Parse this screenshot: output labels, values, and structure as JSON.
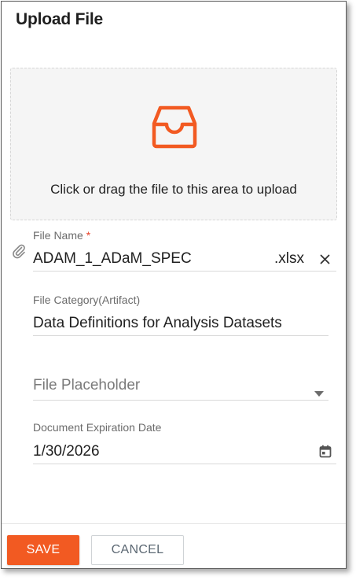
{
  "dialog": {
    "title": "Upload File"
  },
  "dropzone": {
    "icon": "inbox-icon",
    "hint": "Click or drag the file to this area to upload",
    "accent_color": "#f25a22"
  },
  "file_name": {
    "label": "File Name",
    "required_marker": "*",
    "value": "ADAM_1_ADaM_SPEC",
    "extension": ".xlsx",
    "attachment_icon": "paperclip-icon",
    "clear_icon": "close-icon"
  },
  "file_category": {
    "label": "File Category(Artifact)",
    "value": "Data Definitions for Analysis Datasets"
  },
  "file_placeholder": {
    "placeholder": "File Placeholder",
    "icon": "caret-down-icon"
  },
  "expiration": {
    "label": "Document Expiration Date",
    "value": "1/30/2026",
    "icon": "calendar-icon"
  },
  "footer": {
    "save_label": "SAVE",
    "cancel_label": "CANCEL",
    "save_color": "#f25a22"
  }
}
